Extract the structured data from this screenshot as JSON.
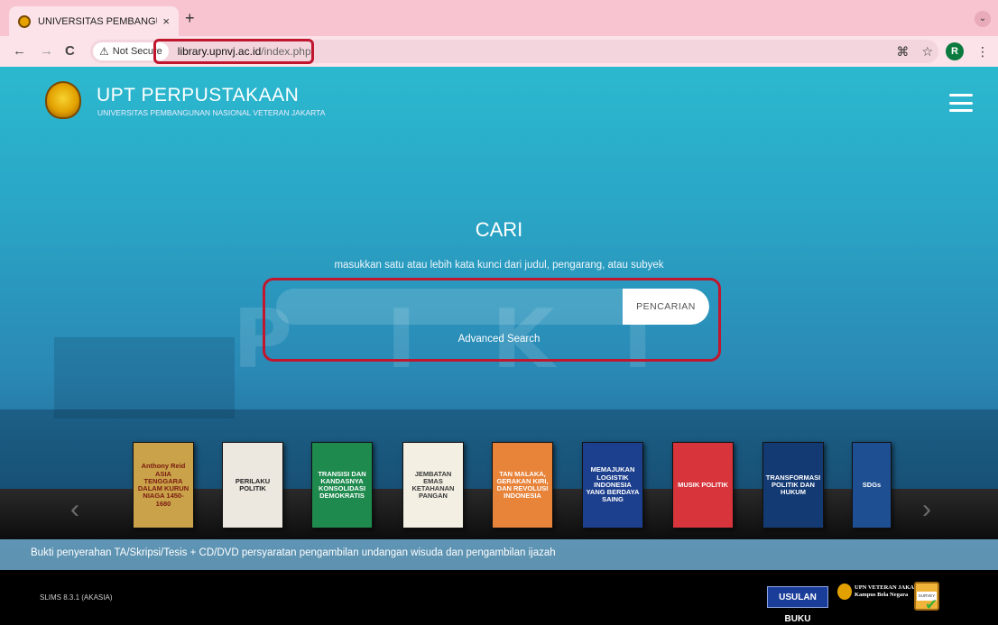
{
  "browser": {
    "tab_title": "UNIVERSITAS PEMBANGUNA",
    "tab_close": "×",
    "new_tab": "+",
    "tab_menu": "⌄",
    "back": "←",
    "forward": "→",
    "reload": "C",
    "security_label": "Not Secure",
    "security_icon": "⚠",
    "url_host": "library.upnvj.ac.id",
    "url_path": "/index.php",
    "translate_icon": "⌘",
    "bookmark_icon": "☆",
    "profile_initial": "R",
    "menu_icon": "⋮"
  },
  "header": {
    "title": "UPT PERPUSTAKAAN",
    "subtitle": "UNIVERSITAS PEMBANGUNAN NASIONAL VETERAN JAKARTA"
  },
  "search": {
    "heading": "CARI",
    "hint": "masukkan satu atau lebih kata kunci dari judul, pengarang, atau subyek",
    "placeholder": "",
    "button_label": "PENCARIAN",
    "advanced_link": "Advanced Search"
  },
  "carousel": {
    "prev": "‹",
    "next": "›",
    "books": [
      {
        "title": "Anthony Reid ASIA TENGGARA DALAM KURUN NIAGA 1450-1680",
        "bg": "#c9a24a",
        "fg": "#7a1a10"
      },
      {
        "title": "PERILAKU POLITIK",
        "bg": "#ece7df",
        "fg": "#222"
      },
      {
        "title": "TRANSISI DAN KANDASNYA KONSOLIDASI DEMOKRATIS",
        "bg": "#1e8a4e",
        "fg": "#ffffff"
      },
      {
        "title": "JEMBATAN EMAS KETAHANAN PANGAN",
        "bg": "#f3efe3",
        "fg": "#3a3a3a"
      },
      {
        "title": "TAN MALAKA, GERAKAN KIRI, DAN REVOLUSI INDONESIA",
        "bg": "#e8833a",
        "fg": "#ffffff"
      },
      {
        "title": "MEMAJUKAN LOGISTIK INDONESIA YANG BERDAYA SAING",
        "bg": "#1c3f8e",
        "fg": "#ffffff"
      },
      {
        "title": "MUSIK POLITIK",
        "bg": "#d7343b",
        "fg": "#ffffff"
      },
      {
        "title": "TRANSFORMASI POLITIK DAN HUKUM",
        "bg": "#143a74",
        "fg": "#ffffff"
      },
      {
        "title": "SDGs",
        "bg": "#1e4f93",
        "fg": "#ffffff"
      }
    ]
  },
  "banner": {
    "text": "Bukti penyerahan TA/Skripsi/Tesis + CD/DVD persyaratan pengambilan undangan wisuda dan pengambilan ijazah"
  },
  "footer": {
    "version": "SLIMS 8.3.1 (AKASIA)",
    "usulan_buku": "USULAN BUKU",
    "upn_line1": "UPN VETERAN JAKARTA",
    "upn_line2": "Kampus Bela Negara",
    "survey": "SURVEY"
  }
}
